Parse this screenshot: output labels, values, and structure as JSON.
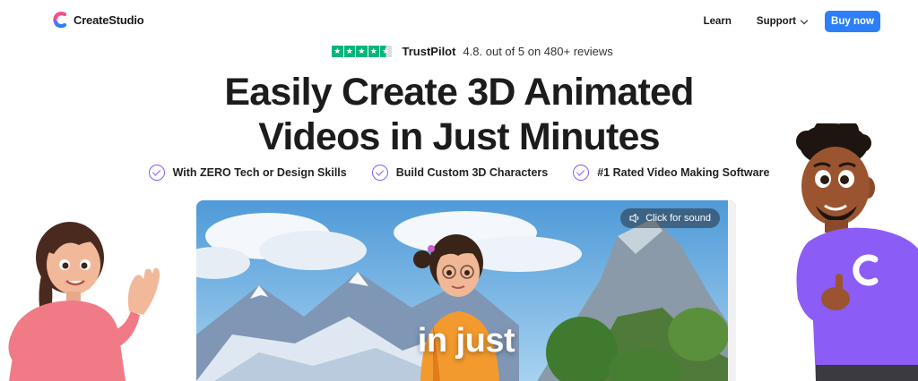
{
  "header": {
    "brand": "CreateStudio",
    "nav": {
      "learn": "Learn",
      "support": "Support",
      "buy": "Buy now"
    }
  },
  "trustpilot": {
    "name": "TrustPilot",
    "score_text": "4.8. out of 5 on 480+ reviews",
    "rating": 4.8
  },
  "hero": {
    "headline_line1": "Easily Create 3D Animated",
    "headline_line2": "Videos in Just Minutes"
  },
  "features": [
    {
      "label": "With ZERO Tech or Design Skills"
    },
    {
      "label": "Build Custom 3D Characters"
    },
    {
      "label": "#1 Rated Video Making Software"
    }
  ],
  "video": {
    "sound_label": "Click for sound",
    "caption": "in just"
  },
  "colors": {
    "accent": "#2d7ff9",
    "check": "#8a5cf6",
    "trustpilot": "#00b67a"
  }
}
